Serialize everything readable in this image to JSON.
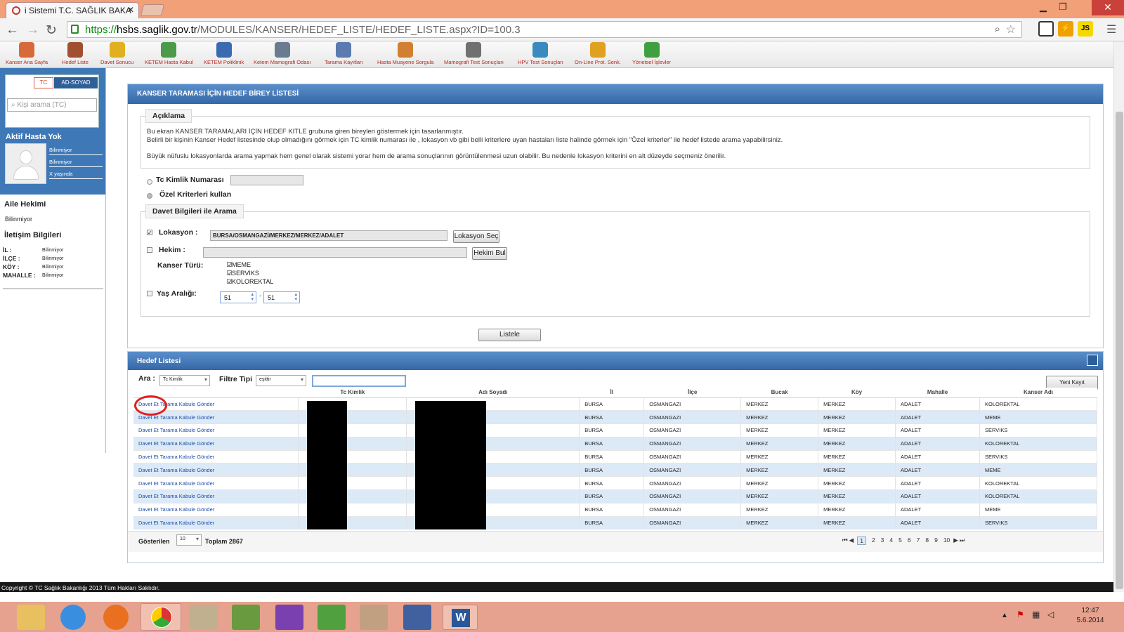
{
  "browser": {
    "tab_title": "i Sistemi T.C. SAĞLIK BAKA",
    "url_scheme": "https://",
    "url_host": "hsbs.saglik.gov.tr",
    "url_path": "/MODULES/KANSER/HEDEF_LISTE/HEDEF_LISTE.aspx?ID=100.3",
    "ext_js": "JS"
  },
  "app_toolbar": [
    "Kanser Ana Sayfa",
    "Hedef Liste",
    "Davet Sonucu",
    "KETEM Hasta Kabul",
    "KETEM Poliklinik",
    "Ketem Mamografi Odası",
    "Tarama Kayıtları",
    "Hasta Muayene Sorgula",
    "Mamografi Test Sonuçları",
    "HPV Test Sonuçları",
    "On-Line Prot. Senk.",
    "Yönetsel İşlevler"
  ],
  "patient": {
    "tab_tc": "TC",
    "tab_adsoyad": "AD-SOYAD",
    "search_placeholder": "Kişi arama (TC)",
    "status": "Aktif Hasta Yok",
    "info": [
      "Bilinmiyor",
      "Bilinmiyor",
      "X yaşında"
    ],
    "aile_title": "Aile Hekimi",
    "aile_value": "Bilinmiyor",
    "iletisim_title": "İletişim Bilgileri",
    "il_l": "İL :",
    "il_v": "Bilinmiyor",
    "ilce_l": "İLÇE :",
    "ilce_v": "Bilinmiyor",
    "koy_l": "KÖY :",
    "koy_v": "Bilinmiyor",
    "mah_l": "MAHALLE :",
    "mah_v": "Bilinmiyor"
  },
  "search_panel": {
    "title": "KANSER TARAMASI İÇİN HEDEF BİREY LİSTESİ",
    "aciklama": "Açıklama",
    "desc1": "Bu ekran KANSER TARAMALARI İÇİN HEDEF KITLE grubuna giren bireyleri göstermek için tasarlanmıştır.",
    "desc2": "Belirli bir kişinin Kanser Hedef listesinde olup olmadığını görmek için TC kimlik numarası ile , lokasyon vb gibi belli kriterlere uyan hastaları liste halinde görmek için \"Özel kriterler\" ile hedef listede arama yapabilirsiniz.",
    "desc3": "Büyük nüfuslu lokasyonlarda arama yapmak hem genel olarak sistemi yorar hem de arama sonuçlarının görüntülenmesi uzun olabilir. Bu nedenle lokasyon kriterini en alt düzeyde seçmeniz önerilir.",
    "tc_label": "Tc Kimlik Numarası",
    "ozel_label": "Özel Kriterleri kullan",
    "davet_legend": "Davet Bilgileri ile Arama",
    "lokasyon_label": "Lokasyon :",
    "lokasyon_value": "BURSA/OSMANGAZİ/MERKEZ/MERKEZ/ADALET",
    "lokasyon_btn": "Lokasyon Seç",
    "hekim_label": "Hekim :",
    "hekim_btn": "Hekim Bul",
    "kanser_label": "Kanser Türü:",
    "kanser_types": [
      "MEME",
      "SERVIKS",
      "KOLOREKTAL"
    ],
    "yas_label": "Yaş Aralığı:",
    "yas_min": "51",
    "yas_dash": "-",
    "yas_max": "51",
    "listele": "Listele"
  },
  "list_panel": {
    "title": "Hedef Listesi",
    "ara_label": "Ara :",
    "ara_value": "Tc Kimlik",
    "filtre_label": "Filtre Tipi",
    "filtre_value": "eşittir",
    "yeni_kayit": "Yeni Kayıt",
    "columns": [
      "",
      "Tc Kimlik",
      "Adı Soyadı",
      "İl",
      "İlçe",
      "Bucak",
      "Köy",
      "Mahalle",
      "Kanser Adı"
    ],
    "rows": [
      [
        "Davet Et Tarama Kabule Gönder",
        "",
        "",
        "BURSA",
        "OSMANGAZI",
        "MERKEZ",
        "MERKEZ",
        "ADALET",
        "KOLOREKTAL"
      ],
      [
        "Davet Et Tarama Kabule Gönder",
        "",
        "",
        "BURSA",
        "OSMANGAZI",
        "MERKEZ",
        "MERKEZ",
        "ADALET",
        "MEME"
      ],
      [
        "Davet Et Tarama Kabule Gönder",
        "",
        "",
        "BURSA",
        "OSMANGAZI",
        "MERKEZ",
        "MERKEZ",
        "ADALET",
        "SERVIKS"
      ],
      [
        "Davet Et Tarama Kabule Gönder",
        "",
        "",
        "BURSA",
        "OSMANGAZI",
        "MERKEZ",
        "MERKEZ",
        "ADALET",
        "KOLOREKTAL"
      ],
      [
        "Davet Et Tarama Kabule Gönder",
        "",
        "",
        "BURSA",
        "OSMANGAZI",
        "MERKEZ",
        "MERKEZ",
        "ADALET",
        "SERVIKS"
      ],
      [
        "Davet Et Tarama Kabule Gönder",
        "",
        "",
        "BURSA",
        "OSMANGAZI",
        "MERKEZ",
        "MERKEZ",
        "ADALET",
        "MEME"
      ],
      [
        "Davet Et Tarama Kabule Gönder",
        "",
        "",
        "BURSA",
        "OSMANGAZI",
        "MERKEZ",
        "MERKEZ",
        "ADALET",
        "KOLOREKTAL"
      ],
      [
        "Davet Et Tarama Kabule Gönder",
        "",
        "",
        "BURSA",
        "OSMANGAZI",
        "MERKEZ",
        "MERKEZ",
        "ADALET",
        "KOLOREKTAL"
      ],
      [
        "Davet Et Tarama Kabule Gönder",
        "",
        "",
        "BURSA",
        "OSMANGAZI",
        "MERKEZ",
        "MERKEZ",
        "ADALET",
        "MEME"
      ],
      [
        "Davet Et Tarama Kabule Gönder",
        "",
        "",
        "BURSA",
        "OSMANGAZI",
        "MERKEZ",
        "MERKEZ",
        "ADALET",
        "SERVIKS"
      ]
    ],
    "gosterilen": "Gösterilen",
    "page_size": "10",
    "toplam": "Toplam 2867",
    "pages": [
      "1",
      "2",
      "3",
      "4",
      "5",
      "6",
      "7",
      "8",
      "9",
      "10"
    ]
  },
  "footer": "Copyright © TC Sağlık Bakanlığı 2013 Tüm Hakları Saklıdır.",
  "clock": {
    "time": "12:47",
    "date": "5.6.2014"
  }
}
